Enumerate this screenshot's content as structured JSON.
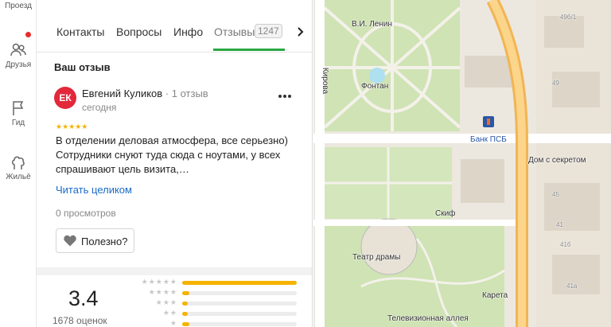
{
  "rail": {
    "items": [
      {
        "label": "Проезд",
        "icon": "route-icon"
      },
      {
        "label": "Друзья",
        "icon": "friends-icon"
      },
      {
        "label": "Гид",
        "icon": "flag-icon"
      },
      {
        "label": "Жильё",
        "icon": "housing-icon"
      }
    ],
    "notification_color": "#e62e2e"
  },
  "tabs": {
    "items": [
      "Контакты",
      "Вопросы",
      "Инфо",
      "Отзывы"
    ],
    "reviews_count": "1247",
    "active": "Отзывы",
    "accent_color": "#2aa844"
  },
  "review": {
    "section_title": "Ваш отзыв",
    "avatar_initials": "ЕК",
    "avatar_color": "#e2283a",
    "author": "Евгений Куликов",
    "author_sub": " · 1 отзыв",
    "date": "сегодня",
    "rating": 5,
    "text": "В отделении деловая атмосфера, все серьезно) Сотрудники снуют туда сюда с ноутами, у всех спрашивают цель визита,…",
    "read_more": "Читать целиком",
    "views": "0 просмотров",
    "useful_label": "Полезно?"
  },
  "summary": {
    "rating": "3.4",
    "count": "1678 оценок",
    "distribution": [
      {
        "stars": 5,
        "fraction": 1.0
      },
      {
        "stars": 4,
        "fraction": 0.06
      },
      {
        "stars": 3,
        "fraction": 0.05
      },
      {
        "stars": 2,
        "fraction": 0.05
      },
      {
        "stars": 1,
        "fraction": 0.06
      }
    ]
  },
  "map": {
    "labels": {
      "lenin": "В.И. Ленин",
      "fountain": "Фонтан",
      "kirova": "Кирова",
      "bank": "Банк ПСБ",
      "house": "Дом с секретом",
      "skif": "Скиф",
      "theatre": "Театр драмы",
      "tv_alley": "Телевизионная аллея",
      "kareta": "Карета",
      "b1": "49б/1",
      "b2": "49",
      "b3": "45",
      "b4": "41",
      "b5": "41б",
      "b6": "41а"
    }
  }
}
